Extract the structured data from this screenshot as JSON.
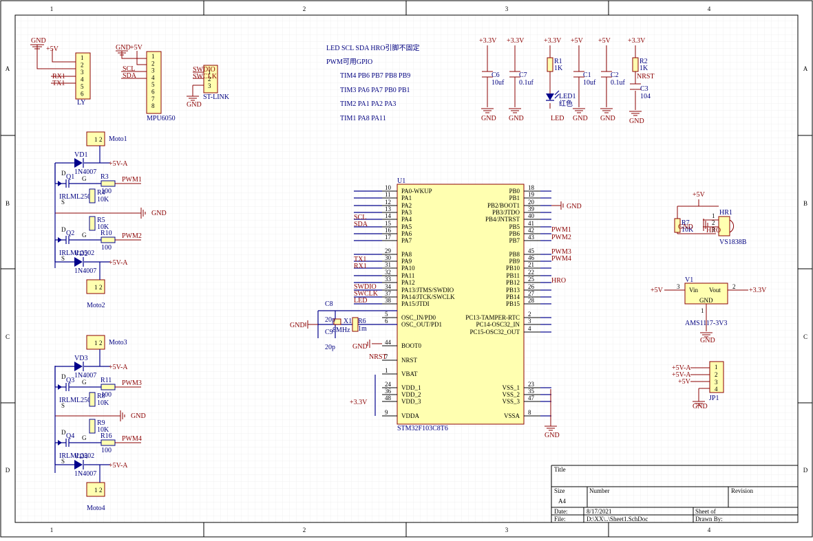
{
  "border": {
    "cols": [
      "1",
      "2",
      "3",
      "4"
    ],
    "rows": [
      "A",
      "B",
      "C",
      "D"
    ]
  },
  "notes": {
    "line1": "LED  SCL SDA HRO引脚不固定",
    "line2": "PWM可用GPIO",
    "tim4": "TIM4  PB6 PB7 PB8 PB9",
    "tim3": "TIM3  PA6 PA7 PB0 PB1",
    "tim2": "TIM2        PA1 PA2 PA3",
    "tim1": "TIM1  PA8               PA11"
  },
  "nets": {
    "gnd": "GND",
    "p5v": "+5V",
    "p5va": "+5V-A",
    "p33v": "+3.3V",
    "scl": "SCL",
    "sda": "SDA",
    "tx1": "TX1",
    "rx1": "RX1",
    "swdio": "SWDIO",
    "swclk": "SWCLK",
    "led": "LED",
    "nrst": "NRST",
    "hro": "HRO",
    "pwm1": "PWM1",
    "pwm2": "PWM2",
    "pwm3": "PWM3",
    "pwm4": "PWM4"
  },
  "ly": {
    "ref": "LY",
    "pins": [
      "1",
      "2",
      "3",
      "4",
      "5",
      "6"
    ]
  },
  "mpu": {
    "ref": "MPU6050",
    "pins": [
      "1",
      "2",
      "3",
      "4",
      "5",
      "6",
      "7",
      "8"
    ]
  },
  "stlink": {
    "ref": "ST-LINK",
    "pins": [
      "1",
      "2",
      "3"
    ]
  },
  "caps": {
    "c6": {
      "ref": "C6",
      "val": "10uf"
    },
    "c7": {
      "ref": "C7",
      "val": "0.1uf"
    },
    "c1": {
      "ref": "C1",
      "val": "10uf"
    },
    "c2": {
      "ref": "C2",
      "val": "0.1uf"
    },
    "c3": {
      "ref": "C3",
      "val": "104"
    },
    "c8": {
      "ref": "C8",
      "val": "20p"
    },
    "c9": {
      "ref": "C9",
      "val": "20p"
    }
  },
  "r1": {
    "ref": "R1",
    "val": "1K"
  },
  "r2": {
    "ref": "R2",
    "val": "1K"
  },
  "led1": {
    "ref": "LED1",
    "val": "红色",
    "net": "LED"
  },
  "motor": {
    "moto1": "Moto1",
    "moto2": "Moto2",
    "moto3": "Moto3",
    "moto4": "Moto4",
    "vd1": "VD1",
    "vd2": "VD2",
    "vd3": "VD3",
    "vd4": "VD4",
    "diode": "1N4007",
    "q1": "Q1",
    "q2": "Q2",
    "q3": "Q3",
    "q4": "Q4",
    "mos": "IRLML2502",
    "r3": "R3",
    "r10": "R10",
    "r11": "R11",
    "r16": "R16",
    "r100": "100",
    "r4": "R4",
    "r5": "R5",
    "r8": "R8",
    "r9": "R9",
    "r10k": "10K",
    "g": "G",
    "s": "S",
    "d": "D",
    "pin1": "1",
    "pin2": "2"
  },
  "mcu": {
    "ref": "U1",
    "part": "STM32F103C8T6",
    "left": [
      {
        "num": "10",
        "name": "PA0-WKUP"
      },
      {
        "num": "11",
        "name": "PA1"
      },
      {
        "num": "12",
        "name": "PA2"
      },
      {
        "num": "13",
        "name": "PA3"
      },
      {
        "num": "14",
        "name": "PA4"
      },
      {
        "num": "15",
        "name": "PA5"
      },
      {
        "num": "16",
        "name": "PA6"
      },
      {
        "num": "17",
        "name": "PA7"
      },
      {
        "num": "29",
        "name": "PA8"
      },
      {
        "num": "30",
        "name": "PA9"
      },
      {
        "num": "31",
        "name": "PA10"
      },
      {
        "num": "32",
        "name": "PA11"
      },
      {
        "num": "33",
        "name": "PA12"
      },
      {
        "num": "34",
        "name": "PA13/JTMS/SWDIO"
      },
      {
        "num": "37",
        "name": "PA14/JTCK/SWCLK"
      },
      {
        "num": "38",
        "name": "PA15/JTDI"
      },
      {
        "num": "5",
        "name": "OSC_IN/PD0"
      },
      {
        "num": "6",
        "name": "OSC_OUT/PD1"
      },
      {
        "num": "44",
        "name": "BOOT0"
      },
      {
        "num": "7",
        "name": "NRST"
      },
      {
        "num": "1",
        "name": "VBAT"
      },
      {
        "num": "24",
        "name": "VDD_1"
      },
      {
        "num": "36",
        "name": "VDD_2"
      },
      {
        "num": "48",
        "name": "VDD_3"
      },
      {
        "num": "9",
        "name": "VDDA"
      }
    ],
    "right": [
      {
        "num": "18",
        "name": "PB0"
      },
      {
        "num": "19",
        "name": "PB1"
      },
      {
        "num": "20",
        "name": "PB2/BOOT1"
      },
      {
        "num": "39",
        "name": "PB3/JTDO"
      },
      {
        "num": "40",
        "name": "PB4/JNTRST"
      },
      {
        "num": "41",
        "name": "PB5"
      },
      {
        "num": "42",
        "name": "PB6"
      },
      {
        "num": "43",
        "name": "PB7"
      },
      {
        "num": "45",
        "name": "PB8"
      },
      {
        "num": "46",
        "name": "PB9"
      },
      {
        "num": "21",
        "name": "PB10"
      },
      {
        "num": "22",
        "name": "PB11"
      },
      {
        "num": "25",
        "name": "PB12"
      },
      {
        "num": "26",
        "name": "PB13"
      },
      {
        "num": "27",
        "name": "PB14"
      },
      {
        "num": "28",
        "name": "PB15"
      },
      {
        "num": "2",
        "name": "PC13-TAMPER-RTC"
      },
      {
        "num": "3",
        "name": "PC14-OSC32_IN"
      },
      {
        "num": "4",
        "name": "PC15-OSC32_OUT"
      },
      {
        "num": "23",
        "name": "VSS_1"
      },
      {
        "num": "35",
        "name": "VSS_2"
      },
      {
        "num": "47",
        "name": "VSS_3"
      },
      {
        "num": "8",
        "name": "VSSA"
      }
    ]
  },
  "crystal": {
    "ref": "X1",
    "val": "8MHz",
    "r6": "R6",
    "r6val": "1m"
  },
  "hr1": {
    "ref": "HR1",
    "part": "VS1838B",
    "r7": "R7",
    "r7val": "10K",
    "pins": [
      "1",
      "2",
      "3"
    ]
  },
  "ldo": {
    "ref": "V1",
    "part": "AMS1117-3V3",
    "vin": "Vin",
    "vout": "Vout",
    "gnd": "GND",
    "p1": "1",
    "p2": "2",
    "p3": "3"
  },
  "jp1": {
    "ref": "JP1",
    "pins": [
      "1",
      "2",
      "3",
      "4"
    ]
  },
  "titleblock": {
    "title": "Title",
    "size": "Size",
    "sizeval": "A4",
    "number": "Number",
    "revision": "Revision",
    "date": "Date:",
    "dateval": "8/17/2021",
    "file": "File:",
    "fileval": "D:\\XX\\..\\Sheet1.SchDoc",
    "sheet": "Sheet   of",
    "drawn": "Drawn By:"
  }
}
